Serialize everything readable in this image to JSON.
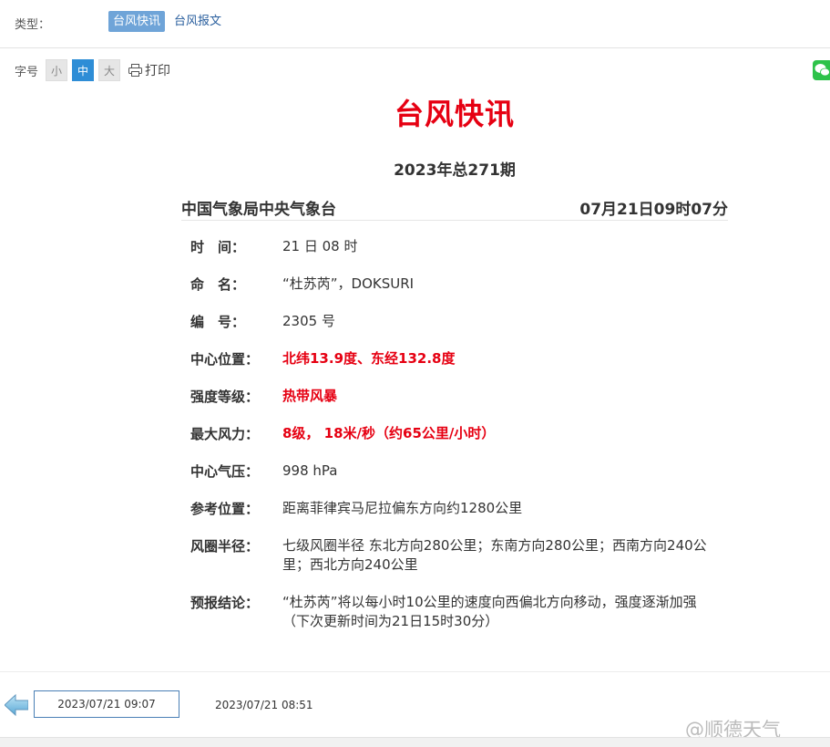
{
  "topbar": {
    "type_label": "类型：",
    "tabs": [
      {
        "label": "台风快讯",
        "active": true
      },
      {
        "label": "台风报文",
        "active": false
      }
    ]
  },
  "toolbar": {
    "font_size_label": "字号",
    "sizes": [
      "小",
      "中",
      "大"
    ],
    "active_size": "中",
    "print_label": "打印"
  },
  "bulletin": {
    "title": "台风快讯",
    "issue": "2023年总271期",
    "issuer": "中国气象局中央气象台",
    "issue_time": "07月21日09时07分",
    "fields": [
      {
        "key": "时　间：",
        "value": "21 日 08 时",
        "highlight": false
      },
      {
        "key": "命　名：",
        "value": "“杜苏芮”，DOKSURI",
        "highlight": false
      },
      {
        "key": "编　号：",
        "value": "2305 号",
        "highlight": false
      },
      {
        "key": "中心位置：",
        "value": "北纬13.9度、东经132.8度",
        "highlight": true
      },
      {
        "key": "强度等级：",
        "value": "热带风暴",
        "highlight": true
      },
      {
        "key": "最大风力：",
        "value": "8级， 18米/秒（约65公里/小时）",
        "highlight": true
      },
      {
        "key": "中心气压：",
        "value": "998 hPa",
        "highlight": false
      },
      {
        "key": "参考位置：",
        "value": "距离菲律宾马尼拉偏东方向约1280公里",
        "highlight": false
      },
      {
        "key": "风圈半径：",
        "value": "七级风圈半径 东北方向280公里；东南方向280公里；西南方向240公里；西北方向240公里",
        "highlight": false
      },
      {
        "key": "预报结论：",
        "value": "“杜苏芮”将以每小时10公里的速度向西偏北方向移动，强度逐渐加强",
        "highlight": false,
        "note": "（下次更新时间为21日15时30分）"
      }
    ]
  },
  "navigation": {
    "current": "2023/07/21 09:07",
    "previous": "2023/07/21 08:51"
  },
  "watermark": "@顺德天气",
  "colors": {
    "title_red": "#e60012",
    "tab_active": "#6fa4d8",
    "size_active": "#2e8dd6",
    "share_green": "#2ec24a"
  },
  "icons": {
    "print": "printer-icon",
    "share": "wechat-icon",
    "back": "arrow-left-icon"
  }
}
